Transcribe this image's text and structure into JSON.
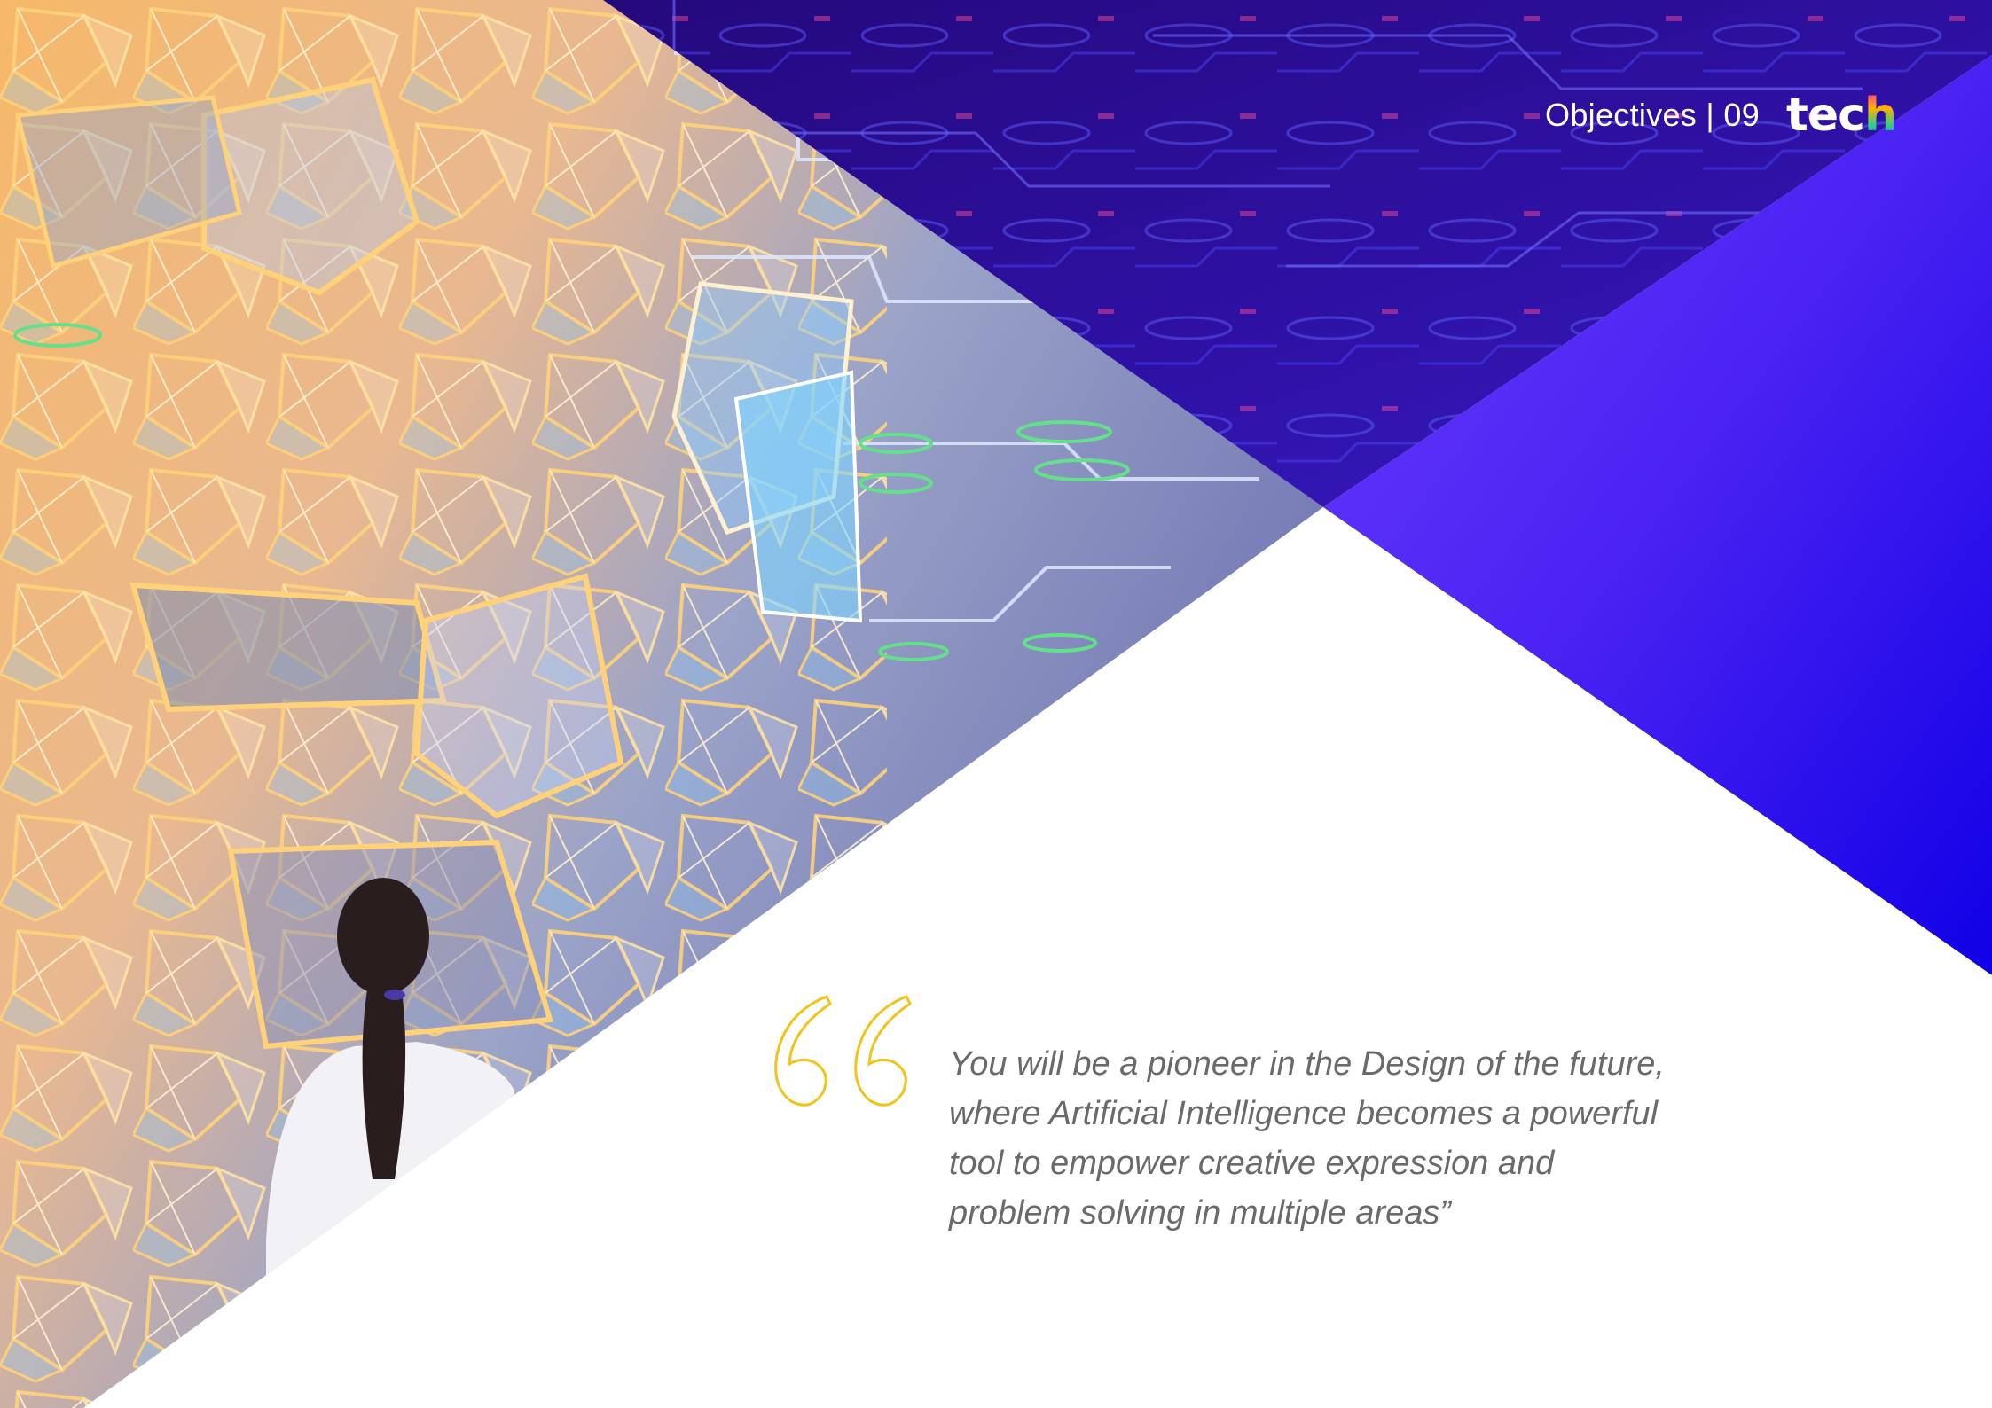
{
  "header": {
    "section_label": "Objectives | 09",
    "logo": {
      "main": "tec",
      "accent": "h"
    }
  },
  "quote": {
    "icon": "quote-mark-icon",
    "lines": [
      "You will be a pioneer in the Design of the future,",
      "where Artificial Intelligence becomes a powerful",
      "tool to empower creative expression and",
      "problem solving in multiple areas”"
    ]
  },
  "colors": {
    "purple_dark": "#2a0a8f",
    "purple_bright": "#5a2bff",
    "blue_deep": "#1400e6",
    "quote_yellow": "#f2c318",
    "quote_text": "#6a6a6a",
    "orange_glow": "#f7a94a"
  }
}
